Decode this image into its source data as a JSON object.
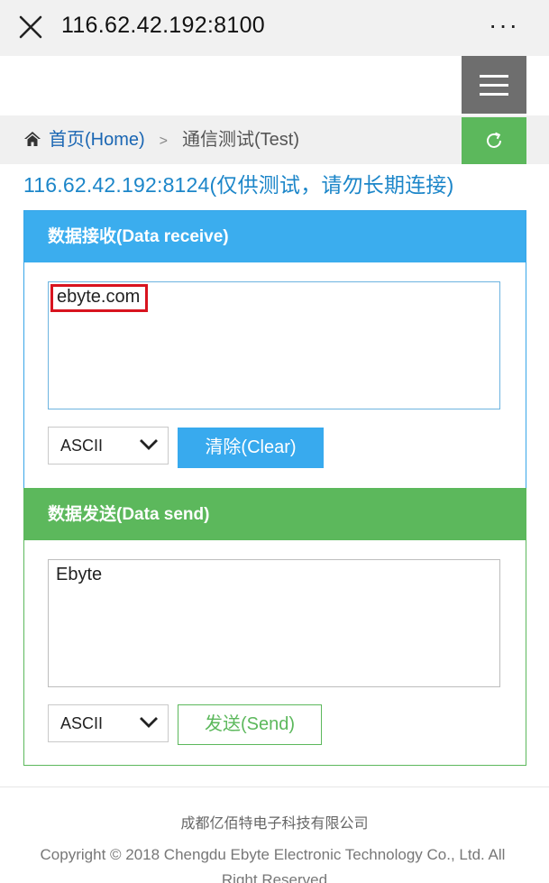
{
  "topbar": {
    "title": "116.62.42.192:8100",
    "more": "···"
  },
  "breadcrumb": {
    "home": "首页(Home)",
    "separator": ">",
    "current": "通信测试(Test)"
  },
  "address_note": "116.62.42.192:8124(仅供测试，请勿长期连接)",
  "receive": {
    "header": "数据接收(Data receive)",
    "text": "ebyte.com",
    "format": "ASCII",
    "clear_label": "清除(Clear)"
  },
  "send": {
    "header": "数据发送(Data send)",
    "text": "Ebyte",
    "format": "ASCII",
    "send_label": "发送(Send)"
  },
  "footer": {
    "company": "成都亿佰特电子科技有限公司",
    "copyright_line1": "Copyright © 2018 Chengdu Ebyte Electronic Technology Co., Ltd. All",
    "copyright_line2": "Right Reserved"
  },
  "colors": {
    "blue": "#3badee",
    "green": "#5cb85c",
    "link": "#1a66b3",
    "highlight": "#d8141f"
  }
}
